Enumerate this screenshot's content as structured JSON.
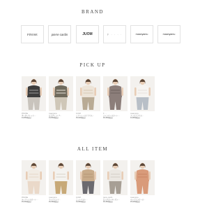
{
  "brand": {
    "title": "BRAND",
    "items": [
      {
        "label": "PINOSE",
        "icon": "brand-logo"
      },
      {
        "label": "pierre cardin",
        "icon": "brand-logo"
      },
      {
        "label": "JUOM",
        "icon": "brand-logo"
      },
      {
        "label": "F · · · ·",
        "icon": "brand-logo"
      },
      {
        "label": "maanyamu",
        "icon": "brand-logo"
      },
      {
        "label": "maanyamu",
        "icon": "brand-logo"
      }
    ]
  },
  "pickup": {
    "title": "PICK UP",
    "items": [
      {
        "l1": "PINOSE",
        "l2": "ボーダーTシャツ…",
        "l3": "¥4,950(税込)",
        "colors": {
          "top": "#3d3d3d",
          "pattern": "#9a9a9a",
          "bottom": "#c9c4bd"
        }
      },
      {
        "l1": "maanyamu",
        "l2": "ロゴプリントT…",
        "l3": "¥4,950(税込)",
        "colors": {
          "top": "#6f6a5c",
          "pattern": "#e8e4da",
          "bottom": "#cfc7b8"
        }
      },
      {
        "l1": "JUOM",
        "l2": "シアーレースブラウス…",
        "l3": "¥5,940(税込)",
        "colors": {
          "top": "#ede4d8",
          "pattern": "#d6c9b5",
          "bottom": "#b9ab95"
        }
      },
      {
        "l1": "F ····",
        "l2": "ジャンパースカート…",
        "l3": "¥6,490(税込)",
        "colors": {
          "top": "#8c7e7a",
          "pattern": "#6e615d",
          "bottom": "#8c7e7a"
        }
      },
      {
        "l1": "maanyamu",
        "l2": "フリルブラウス…",
        "l3": "¥4,950(税込)",
        "colors": {
          "top": "#f6f4f1",
          "pattern": "#e6e1db",
          "bottom": "#b8bfc7"
        }
      }
    ]
  },
  "allitem": {
    "title": "ALL ITEM",
    "items": [
      {
        "l1": "PINOSE",
        "l2": "ティアードスカート…",
        "l3": "¥5,940(税込)",
        "colors": {
          "top": "#f2ece4",
          "pattern": "#e6d8c8",
          "bottom": "#ead9c9"
        }
      },
      {
        "l1": "maanyamu",
        "l2": "ワイドパンツ…",
        "l3": "¥5,390(税込)",
        "colors": {
          "top": "#f4f3f0",
          "pattern": "#d9d3c8",
          "bottom": "#c7a978"
        }
      },
      {
        "l1": "JUOM",
        "l2": "ニットベスト…",
        "l3": "¥4,950(税込)",
        "colors": {
          "top": "#c8ab8a",
          "pattern": "#b69676",
          "bottom": "#6b6a6f"
        }
      },
      {
        "l1": "pierre cardin",
        "l2": "ロングカーディガン…",
        "l3": "¥6,490(税込)",
        "colors": {
          "top": "#ebe7e2",
          "pattern": "#d3cdc5",
          "bottom": "#a79f95"
        }
      },
      {
        "l1": "maanyamu",
        "l2": "キャミワンピース…",
        "l3": "¥5,940(税込)",
        "colors": {
          "top": "#d99b7a",
          "pattern": "#c98664",
          "bottom": "#d99b7a"
        }
      }
    ]
  }
}
